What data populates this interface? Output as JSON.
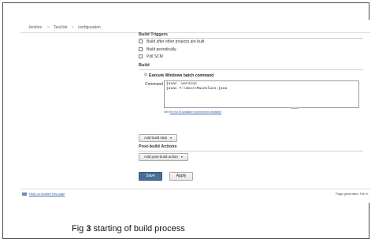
{
  "breadcrumb": {
    "items": [
      "Jenkins",
      "TestJob",
      "configuration"
    ],
    "separator": "»"
  },
  "build_triggers": {
    "heading": "Build Triggers",
    "options": [
      {
        "label": "Build after other projects are built",
        "checked": false
      },
      {
        "label": "Build periodically",
        "checked": false
      },
      {
        "label": "Poll SCM",
        "checked": false
      }
    ]
  },
  "build": {
    "heading": "Build",
    "step_title": "Execute Windows batch command",
    "command_label": "Command",
    "command_lines": [
      "javac -version",
      "javac F:\\docs\\MainClass.java"
    ],
    "hint_prefix": "See",
    "hint_link": "the list of available environment variables",
    "add_build_step": "Add build step"
  },
  "post_build": {
    "heading": "Post-build Actions",
    "add_action": "Add post-build action"
  },
  "actions": {
    "save": "Save",
    "apply": "Apply"
  },
  "footer": {
    "help_link": "Help us localize this page",
    "generated": "Page generated: Feb 9,"
  },
  "caption": {
    "prefix": "Fig",
    "number": "3",
    "text": "starting of build process"
  },
  "colors": {
    "save_button": "#4a6e95",
    "link": "#3366aa"
  }
}
